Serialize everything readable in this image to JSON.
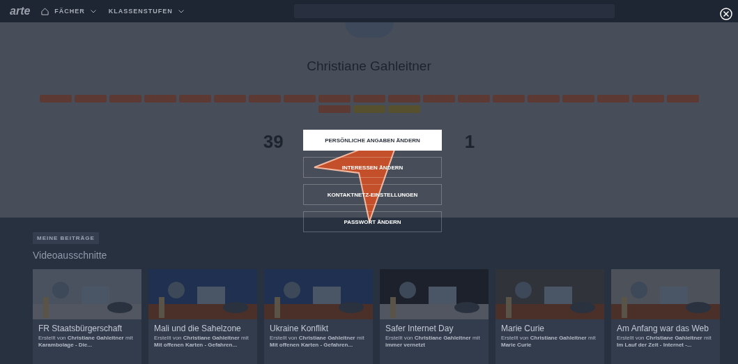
{
  "topbar": {
    "logo": "arte",
    "menus": [
      {
        "label": "FÄCHER"
      },
      {
        "label": "KLASSENSTUFEN"
      }
    ]
  },
  "profile": {
    "name": "Christiane Gahleitner",
    "tags": [
      {
        "color": "#5c3a33"
      },
      {
        "color": "#5c3a33"
      },
      {
        "color": "#5c3a33"
      },
      {
        "color": "#5c3a33"
      },
      {
        "color": "#5c3a33"
      },
      {
        "color": "#5c3a33"
      },
      {
        "color": "#5c3a33"
      },
      {
        "color": "#5c3a33"
      },
      {
        "color": "#5c3a33"
      },
      {
        "color": "#5c3a33"
      },
      {
        "color": "#5c3a33"
      },
      {
        "color": "#5c3a33"
      },
      {
        "color": "#5c3a33"
      },
      {
        "color": "#5c3a33"
      },
      {
        "color": "#5c3a33"
      },
      {
        "color": "#5c3a33"
      },
      {
        "color": "#5c3a33"
      },
      {
        "color": "#5c3a33"
      },
      {
        "color": "#5c3a33"
      },
      {
        "color": "#5c3a33"
      },
      {
        "color": "#56502e"
      },
      {
        "color": "#56502e"
      }
    ],
    "stats": [
      {
        "value": "39"
      },
      {
        "value": "1"
      }
    ]
  },
  "menu": [
    {
      "label": "PERSÖNLICHE ANGABEN ÄNDERN",
      "selected": true
    },
    {
      "label": "INTERESSEN ÄNDERN",
      "selected": false
    },
    {
      "label": "KONTAKTNETZ-EINSTELLUNGEN",
      "selected": false
    },
    {
      "label": "PASSWORT ÄNDERN",
      "selected": false
    }
  ],
  "contributions": {
    "badge": "MEINE BEITRÄGE",
    "heading": "Videoausschnitte",
    "cards": [
      {
        "title": "FR Staatsbürgerschaft",
        "byline": "Erstellt von **Christiane Gahleitner** mit **Karambolage - Die...**"
      },
      {
        "title": "Mali und die Sahelzone",
        "byline": "Erstellt von **Christiane Gahleitner** mit **Mit offenen Karten - Gefahren...**"
      },
      {
        "title": "Ukraine Konflikt",
        "byline": "Erstellt von **Christiane Gahleitner** mit **Mit offenen Karten - Gefahren...**"
      },
      {
        "title": "Safer Internet Day",
        "byline": "Erstellt von **Christiane Gahleitner** mit **immer vernetzt**"
      },
      {
        "title": "Marie Curie",
        "byline": "Erstellt von **Christiane Gahleitner** mit **Marie Curie**"
      },
      {
        "title": "Am Anfang war das Web",
        "byline": "Erstellt von **Christiane Gahleitner** mit **Im Lauf der Zeit - Internet -...**"
      }
    ]
  }
}
